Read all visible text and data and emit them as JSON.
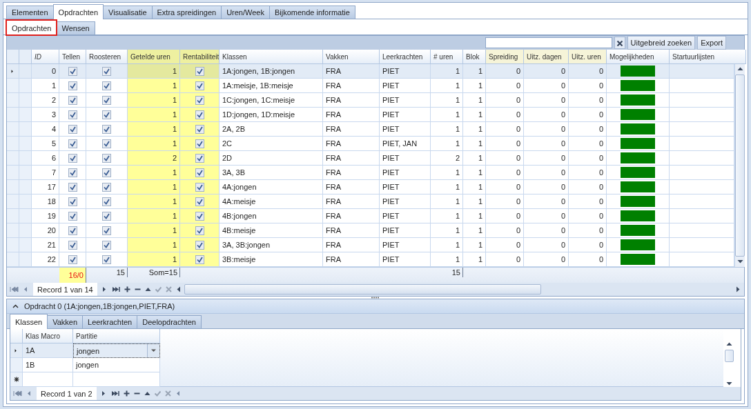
{
  "tabs": [
    {
      "label": "Elementen",
      "selected": false
    },
    {
      "label": "Opdrachten",
      "selected": true
    },
    {
      "label": "Visualisatie",
      "selected": false
    },
    {
      "label": "Extra spreidingen",
      "selected": false
    },
    {
      "label": "Uren/Week",
      "selected": false
    },
    {
      "label": "Bijkomende informatie",
      "selected": false
    }
  ],
  "subtabs": [
    {
      "label": "Opdrachten",
      "selected": true,
      "outlined": true
    },
    {
      "label": "Wensen",
      "selected": false,
      "outlined": false
    }
  ],
  "toolbar": {
    "buttons": [
      "Uitgebreid zoeken",
      "Export"
    ]
  },
  "grid": {
    "columns": [
      {
        "label": "ID",
        "kind": "number",
        "italic": true,
        "highlighted": false
      },
      {
        "label": "Tellen",
        "kind": "check",
        "italic": false,
        "highlighted": false,
        "total": {
          "text": "16/0",
          "warning": true
        }
      },
      {
        "label": "Roosteren",
        "kind": "check",
        "italic": false,
        "highlighted": false,
        "total": {
          "text": "15",
          "warning": false
        }
      },
      {
        "label": "Getelde uren",
        "kind": "number",
        "italic": false,
        "highlighted": true,
        "color": "#eef0a0",
        "total": {
          "text": "Som=15",
          "warning": false
        }
      },
      {
        "label": "Rentabiliteit",
        "kind": "check",
        "italic": false,
        "highlighted": true,
        "color": "#eef0a0"
      },
      {
        "label": "Klassen",
        "kind": "text",
        "italic": false,
        "highlighted": false
      },
      {
        "label": "Vakken",
        "kind": "text",
        "italic": false,
        "highlighted": false
      },
      {
        "label": "Leerkrachten",
        "kind": "text",
        "italic": false,
        "highlighted": false
      },
      {
        "label": "# uren",
        "kind": "number",
        "italic": false,
        "highlighted": false,
        "total": {
          "text": "15",
          "warning": false
        }
      },
      {
        "label": "Blok",
        "kind": "number",
        "italic": false,
        "highlighted": false
      },
      {
        "label": "Spreiding",
        "kind": "number",
        "italic": false,
        "highlighted": false,
        "color": "#f6f4d8"
      },
      {
        "label": "Uitz. dagen",
        "kind": "number",
        "italic": false,
        "highlighted": false,
        "color": "#f6f4d8"
      },
      {
        "label": "Uitz. uren",
        "kind": "number",
        "italic": false,
        "highlighted": false,
        "color": "#f6f4d8"
      },
      {
        "label": "Mogelijkheden",
        "kind": "bar",
        "italic": false,
        "highlighted": false
      },
      {
        "label": "Startuurlijsten",
        "kind": "text",
        "italic": false,
        "highlighted": false
      }
    ],
    "rows": [
      {
        "selected": true,
        "cells": [
          "0",
          true,
          true,
          "1",
          true,
          "1A:jongen, 1B:jongen",
          "FRA",
          "PIET",
          "1",
          "1",
          "0",
          "0",
          "0",
          {
            "color": "#008000"
          },
          null
        ]
      },
      {
        "selected": false,
        "cells": [
          "1",
          true,
          true,
          "1",
          true,
          "1A:meisje, 1B:meisje",
          "FRA",
          "PIET",
          "1",
          "1",
          "0",
          "0",
          "0",
          {
            "color": "#008000"
          },
          null
        ]
      },
      {
        "selected": false,
        "cells": [
          "2",
          true,
          true,
          "1",
          true,
          "1C:jongen, 1C:meisje",
          "FRA",
          "PIET",
          "1",
          "1",
          "0",
          "0",
          "0",
          {
            "color": "#008000"
          },
          null
        ]
      },
      {
        "selected": false,
        "cells": [
          "3",
          true,
          true,
          "1",
          true,
          "1D:jongen, 1D:meisje",
          "FRA",
          "PIET",
          "1",
          "1",
          "0",
          "0",
          "0",
          {
            "color": "#008000"
          },
          null
        ]
      },
      {
        "selected": false,
        "cells": [
          "4",
          true,
          true,
          "1",
          true,
          "2A, 2B",
          "FRA",
          "PIET",
          "1",
          "1",
          "0",
          "0",
          "0",
          {
            "color": "#008000"
          },
          null
        ]
      },
      {
        "selected": false,
        "cells": [
          "5",
          true,
          true,
          "1",
          true,
          "2C",
          "FRA",
          "PIET, JAN",
          "1",
          "1",
          "0",
          "0",
          "0",
          {
            "color": "#008000"
          },
          null
        ]
      },
      {
        "selected": false,
        "cells": [
          "6",
          true,
          true,
          "2",
          true,
          "2D",
          "FRA",
          "PIET",
          "2",
          "1",
          "0",
          "0",
          "0",
          {
            "color": "#008000"
          },
          null
        ]
      },
      {
        "selected": false,
        "cells": [
          "7",
          true,
          true,
          "1",
          true,
          "3A, 3B",
          "FRA",
          "PIET",
          "1",
          "1",
          "0",
          "0",
          "0",
          {
            "color": "#008000"
          },
          null
        ]
      },
      {
        "selected": false,
        "cells": [
          "17",
          true,
          true,
          "1",
          true,
          "4A:jongen",
          "FRA",
          "PIET",
          "1",
          "1",
          "0",
          "0",
          "0",
          {
            "color": "#008000"
          },
          null
        ]
      },
      {
        "selected": false,
        "cells": [
          "18",
          true,
          true,
          "1",
          true,
          "4A:meisje",
          "FRA",
          "PIET",
          "1",
          "1",
          "0",
          "0",
          "0",
          {
            "color": "#008000"
          },
          null
        ]
      },
      {
        "selected": false,
        "cells": [
          "19",
          true,
          true,
          "1",
          true,
          "4B:jongen",
          "FRA",
          "PIET",
          "1",
          "1",
          "0",
          "0",
          "0",
          {
            "color": "#008000"
          },
          null
        ]
      },
      {
        "selected": false,
        "cells": [
          "20",
          true,
          true,
          "1",
          true,
          "4B:meisje",
          "FRA",
          "PIET",
          "1",
          "1",
          "0",
          "0",
          "0",
          {
            "color": "#008000"
          },
          null
        ]
      },
      {
        "selected": false,
        "cells": [
          "21",
          true,
          true,
          "1",
          true,
          "3A, 3B:jongen",
          "FRA",
          "PIET",
          "1",
          "1",
          "0",
          "0",
          "0",
          {
            "color": "#008000"
          },
          null
        ]
      },
      {
        "selected": false,
        "cells": [
          "22",
          true,
          true,
          "1",
          true,
          "3B:meisje",
          "FRA",
          "PIET",
          "1",
          "1",
          "0",
          "0",
          "0",
          {
            "color": "#008000"
          },
          null
        ]
      }
    ],
    "navigator": "Record 1 van 14"
  },
  "detail": {
    "title": "Opdracht 0 (1A:jongen,1B:jongen,PIET,FRA)",
    "expanded": true,
    "tabs": [
      {
        "label": "Klassen",
        "selected": true
      },
      {
        "label": "Vakken",
        "selected": false
      },
      {
        "label": "Leerkrachten",
        "selected": false
      },
      {
        "label": "Deelopdrachten",
        "selected": false
      }
    ],
    "columns": [
      "Klas Macro",
      "Partitie"
    ],
    "rows": [
      {
        "selected": true,
        "cells": [
          "1A",
          "jongen"
        ]
      },
      {
        "selected": false,
        "cells": [
          "1B",
          "jongen"
        ]
      }
    ],
    "navigator": "Record 1 van 2"
  }
}
